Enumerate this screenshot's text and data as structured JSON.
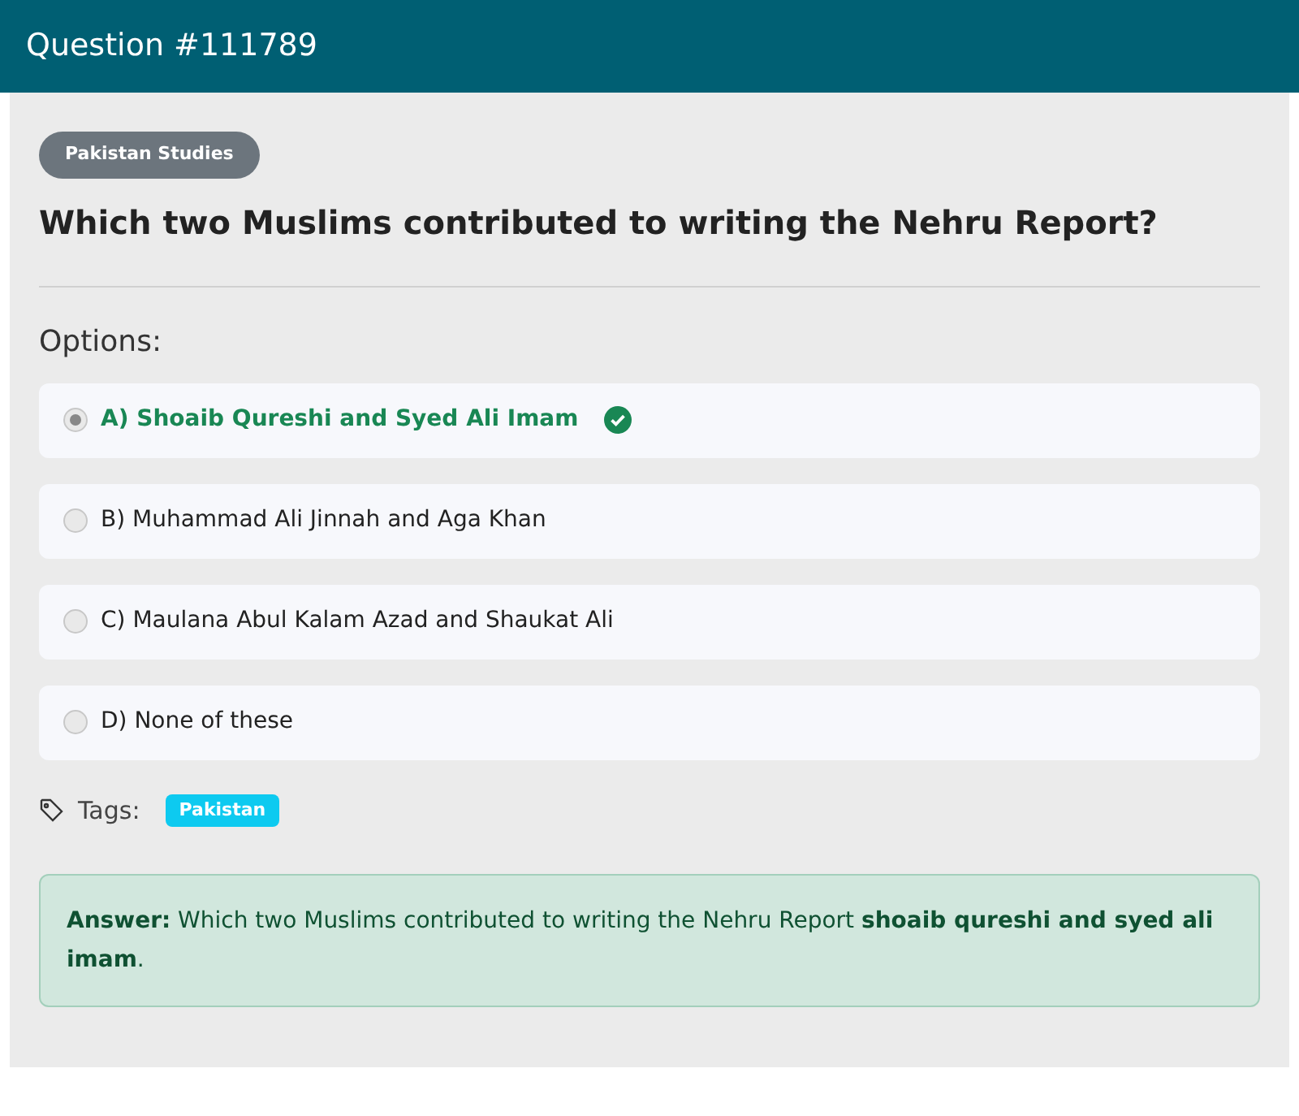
{
  "header": {
    "title": "Question #111789"
  },
  "category": "Pakistan Studies",
  "question": "Which two Muslims contributed to writing the Nehru Report?",
  "options_label": "Options:",
  "options": [
    {
      "text": "A) Shoaib Qureshi and Syed Ali Imam",
      "selected": true,
      "correct": true
    },
    {
      "text": "B) Muhammad Ali Jinnah and Aga Khan",
      "selected": false,
      "correct": false
    },
    {
      "text": "C) Maulana Abul Kalam Azad and Shaukat Ali",
      "selected": false,
      "correct": false
    },
    {
      "text": "D) None of these",
      "selected": false,
      "correct": false
    }
  ],
  "tags_label": "Tags:",
  "tags": [
    "Pakistan"
  ],
  "answer": "**Answer:** Which two Muslims contributed to writing the Nehru Report **shoaib qureshi and syed ali imam**."
}
